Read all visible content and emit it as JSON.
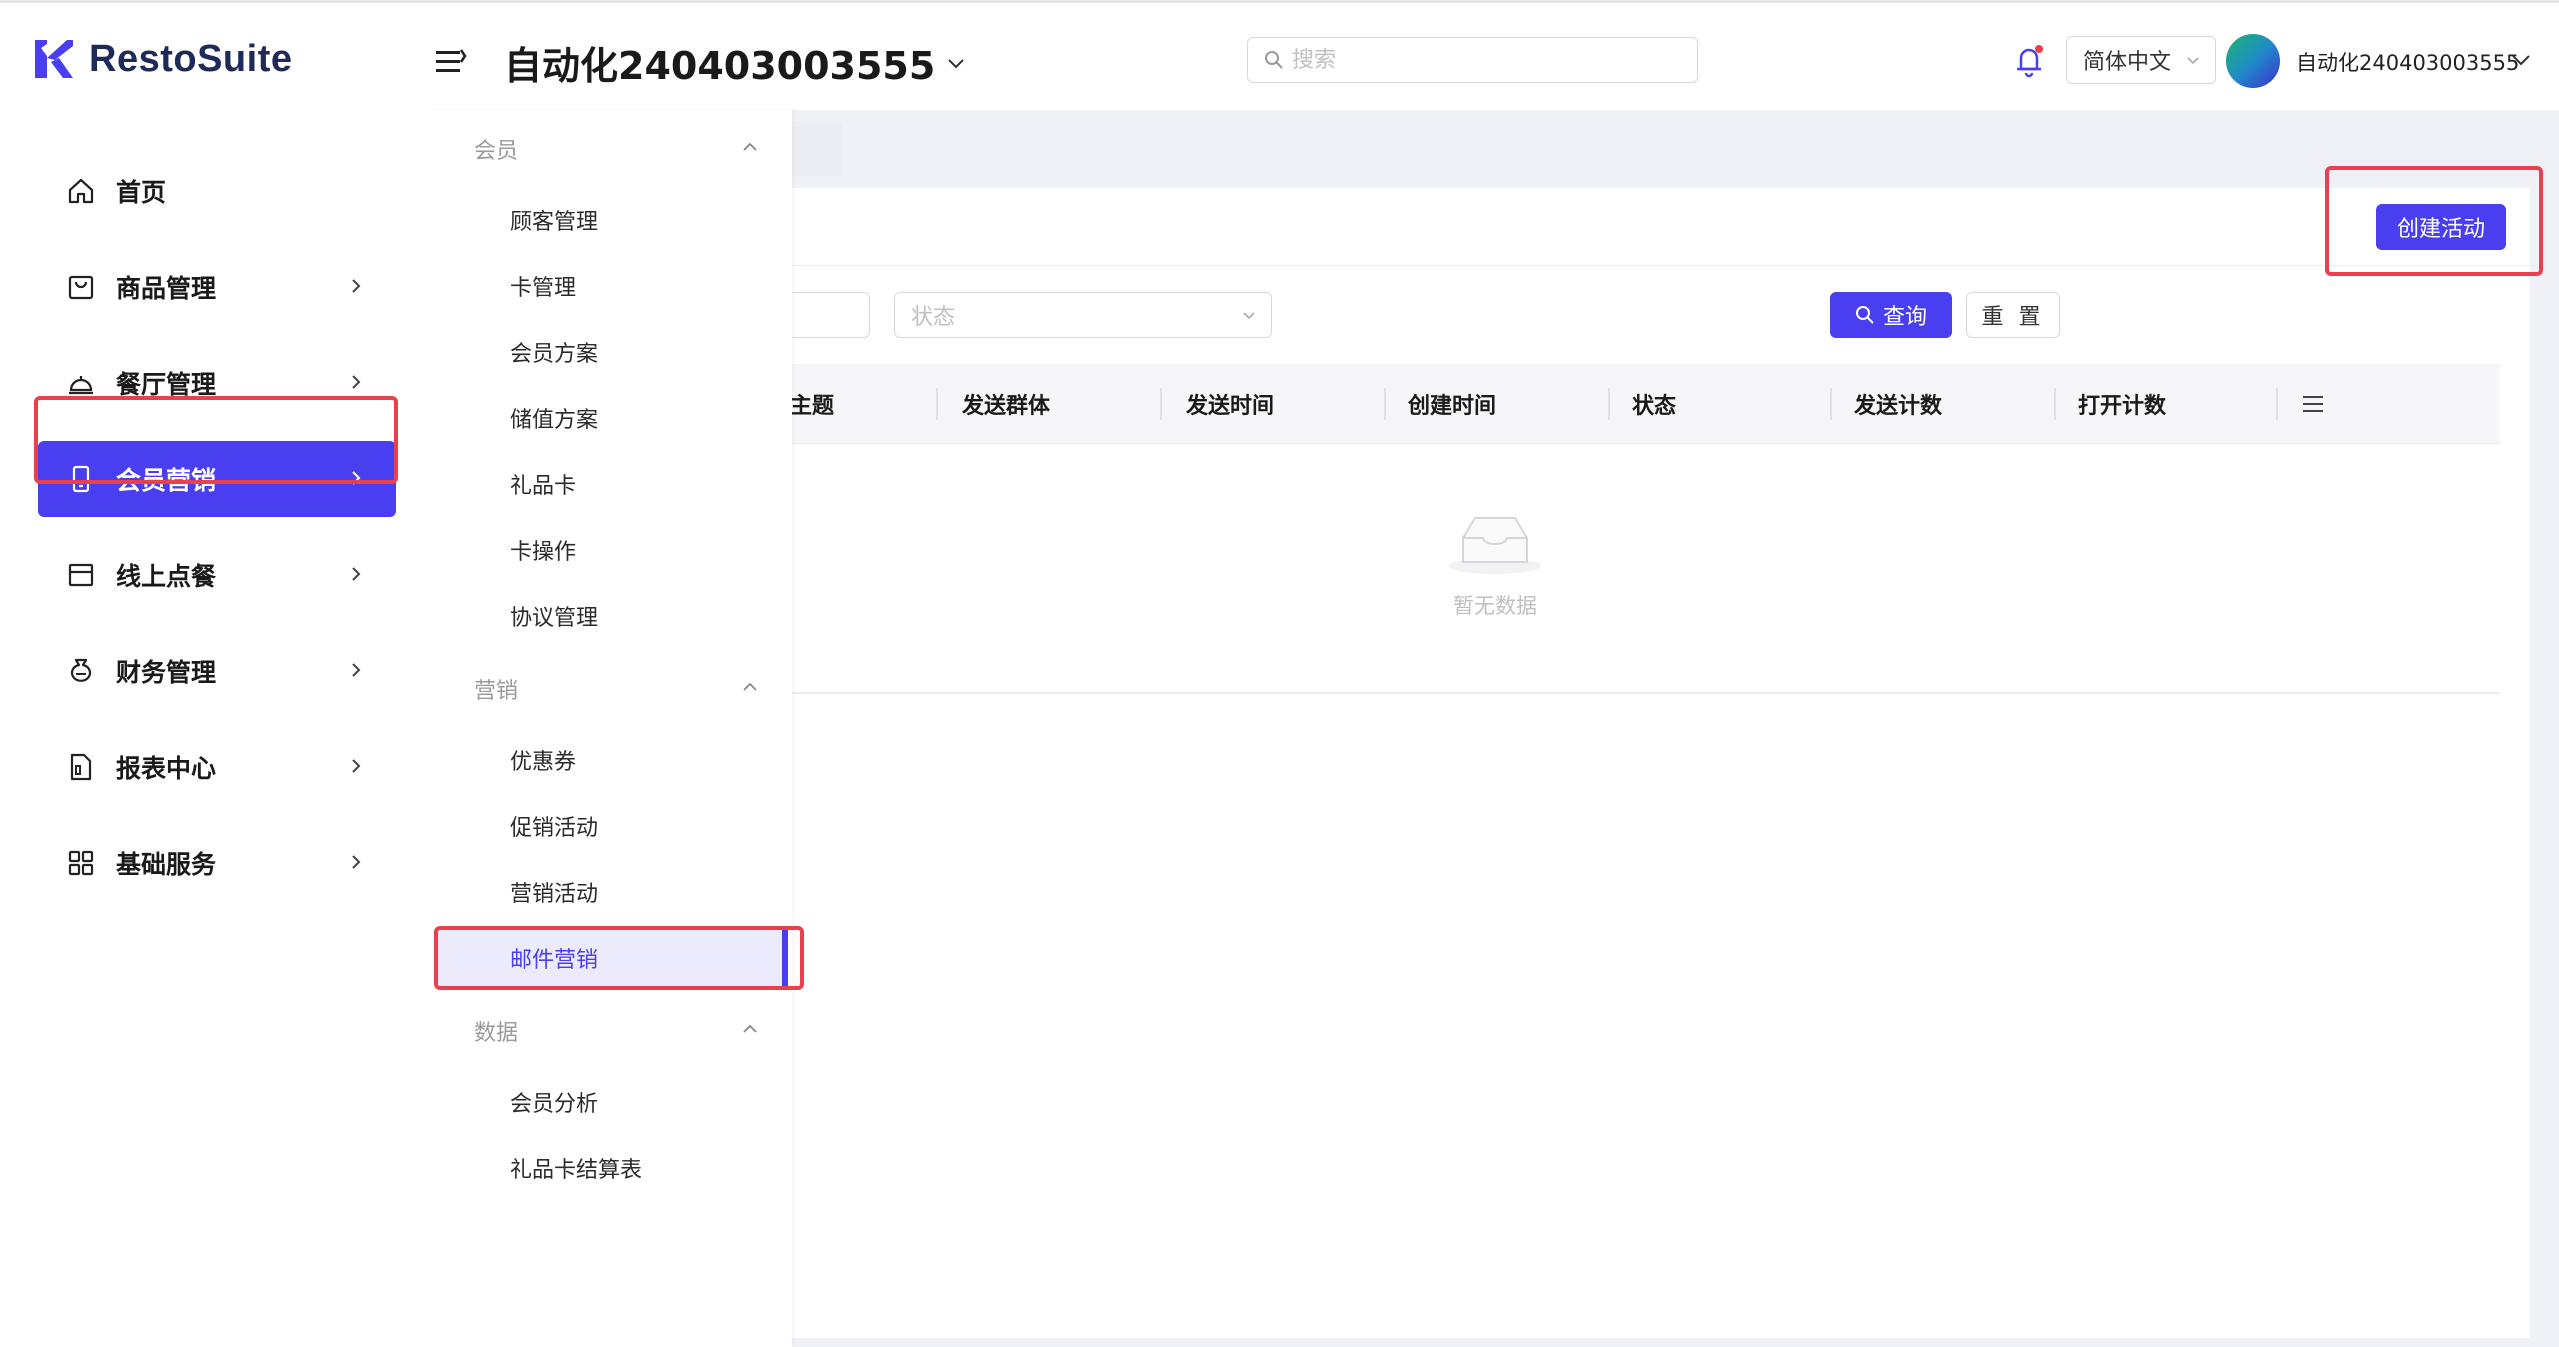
{
  "brand": {
    "name": "RestoSuite",
    "color": "#4a3ff0"
  },
  "header": {
    "store_title": "自动化240403003555",
    "search_placeholder": "搜索",
    "language": "简体中文",
    "user_name": "自动化240403003555"
  },
  "sidebar": {
    "items": [
      {
        "label": "首页",
        "icon": "home-icon"
      },
      {
        "label": "商品管理",
        "icon": "bag-icon"
      },
      {
        "label": "餐厅管理",
        "icon": "cloche-icon"
      },
      {
        "label": "会员营销",
        "icon": "phone-icon",
        "active": true
      },
      {
        "label": "线上点餐",
        "icon": "box-icon"
      },
      {
        "label": "财务管理",
        "icon": "moneybag-icon"
      },
      {
        "label": "报表中心",
        "icon": "report-icon"
      },
      {
        "label": "基础服务",
        "icon": "grid-icon"
      }
    ]
  },
  "submenu": {
    "groups": [
      {
        "title": "会员",
        "items": [
          "顾客管理",
          "卡管理",
          "会员方案",
          "储值方案",
          "礼品卡",
          "卡操作",
          "协议管理"
        ]
      },
      {
        "title": "营销",
        "items": [
          "优惠券",
          "促销活动",
          "营销活动",
          "邮件营销"
        ]
      },
      {
        "title": "数据",
        "items": [
          "会员分析",
          "礼品卡结算表"
        ]
      }
    ],
    "active_item": "邮件营销"
  },
  "page": {
    "create_button": "创建活动",
    "status_placeholder": "状态",
    "query_button": "查询",
    "reset_button": "重 置",
    "columns": [
      "主题",
      "发送群体",
      "发送时间",
      "创建时间",
      "状态",
      "发送计数",
      "打开计数"
    ],
    "empty_text": "暂无数据"
  },
  "colors": {
    "accent": "#4a3ff0",
    "highlight": "#e8404e",
    "background": "#f0f1f7"
  }
}
